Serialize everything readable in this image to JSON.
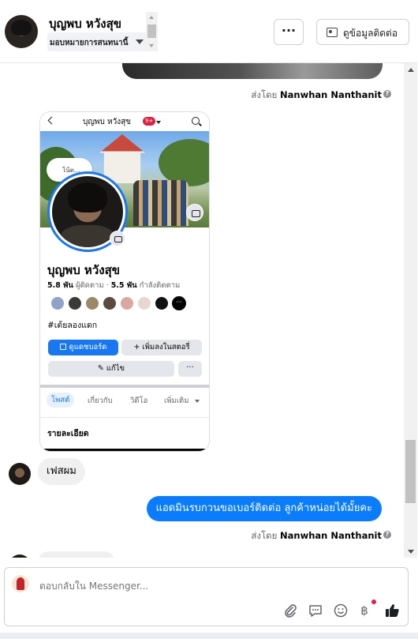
{
  "header": {
    "contact_name": "บุญพบ หวังสุข",
    "assign_label": "มอบหมายการสนทนานี้",
    "more_label": "···",
    "contact_info_label": "ดูข้อมูลติดต่อ"
  },
  "thread": {
    "sent_by_prefix_1": "ส่งโดย",
    "sent_by_name_1": "Nanwhan Nanthanit",
    "screenshot": {
      "title": "บุญพบ หวังสุข",
      "badge": "9+",
      "note_text": "โน้ต...",
      "profile_name": "บุญพบ หวังสุข",
      "followers_count": "5.8 พัน",
      "followers_label": "ผู้ติดตาม",
      "following_count": "5.5 พัน",
      "following_label": "กำลังติดตาม",
      "friends_more": "···",
      "hashtag": "#เต้ยลองแดก",
      "btn_dashboard": "ดูแดชบอร์ด",
      "btn_add_story": "+ เพิ่มลงในสตอรี่",
      "btn_edit": "✎ แก้ไข",
      "btn_more": "···",
      "tabs": [
        "โพสต์",
        "เกี่ยวกับ",
        "วิดีโอ",
        "เพิ่มเติม"
      ],
      "details_label": "รายละเอียด"
    },
    "incoming_message": "เฟสผม",
    "outgoing_message": "แอดมินรบกวนขอเบอร์ติดต่อ ลูกค้าหน่อยได้มั้ยคะ",
    "sent_by_prefix_2": "ส่งโดย",
    "sent_by_name_2": "Nanwhan Nanthanit",
    "info_glyph": "?"
  },
  "composer": {
    "placeholder": "ตอบกลับใน Messenger...",
    "baht_glyph": "฿"
  },
  "colors": {
    "accent": "#0a7cff",
    "fb_blue": "#1877f2",
    "notification_red": "#e41e3f",
    "muted_text": "#65676b"
  },
  "icons": {
    "attach": "paperclip-icon",
    "saved_replies": "chat-bubble-icon",
    "emoji": "smiley-icon",
    "payment": "baht-icon",
    "like": "thumbs-up-icon"
  }
}
